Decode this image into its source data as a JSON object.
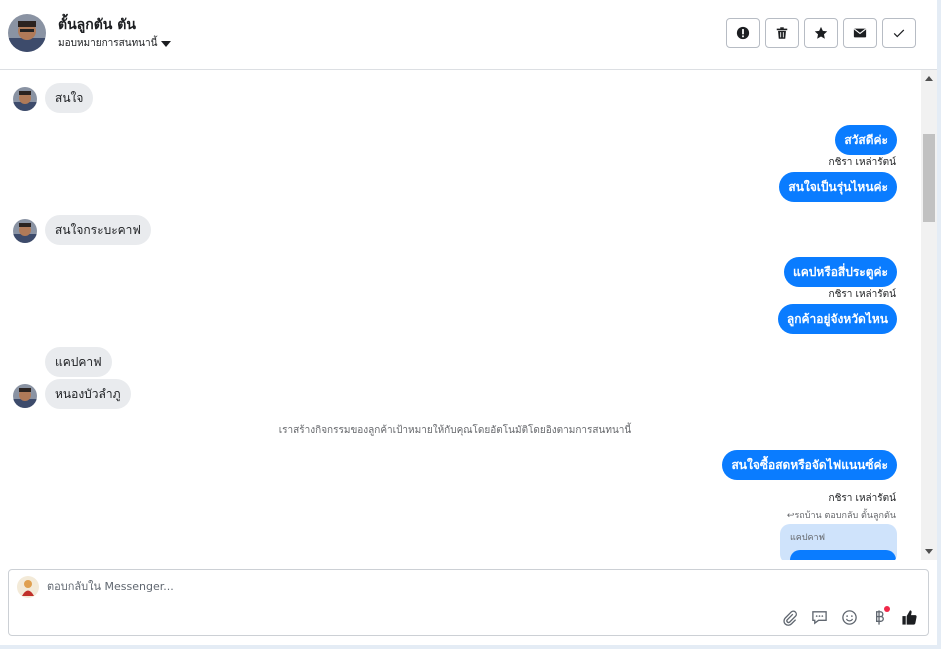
{
  "header": {
    "contact_name": "ตั้นลูกตัน ตัน",
    "assign_label": "มอบหมายการสนทนานี้",
    "actions": [
      {
        "name": "spam-button",
        "icon": "alert-icon"
      },
      {
        "name": "delete-button",
        "icon": "trash-icon"
      },
      {
        "name": "follow-up-button",
        "icon": "star-icon"
      },
      {
        "name": "mark-unread-button",
        "icon": "envelope-icon"
      },
      {
        "name": "mark-done-button",
        "icon": "check-icon"
      }
    ]
  },
  "messages": {
    "m1": "สนใจ",
    "m2": "สวัสดีค่ะ",
    "sender": "กชิรา เหล่ารัตน์",
    "m3": "สนใจเป็นรุ่นไหนค่ะ",
    "m4": "สนใจกระบะคาฟ",
    "m5": "แคปหรือสี่ประตูค่ะ",
    "m6": "ลูกค้าอยู่จังหวัดไหน",
    "m7": "แคปคาฟ",
    "m8": "หนองบัวลำภู",
    "system": "เราสร้างกิจกรรมของลูกค้าเป้าหมายให้กับคุณโดยอัตโนมัติโดยอิงตามการสนทนานี้",
    "m9": "สนใจซื้อสดหรือจัดไฟแนนซ์ค่ะ",
    "reply_note": "รถบ้าน ตอบกลับ ตั้นลูกตัน",
    "quote": "แคปคาฟ"
  },
  "composer": {
    "placeholder": "ตอบกลับใน Messenger...",
    "value": "",
    "tools": [
      "attach-icon",
      "saved-reply-icon",
      "emoji-icon",
      "baht-icon",
      "thumbs-up-icon"
    ]
  },
  "colors": {
    "outgoing": "#0a7cff",
    "incoming": "#e9ebee",
    "notification_dot": "#f02849"
  }
}
